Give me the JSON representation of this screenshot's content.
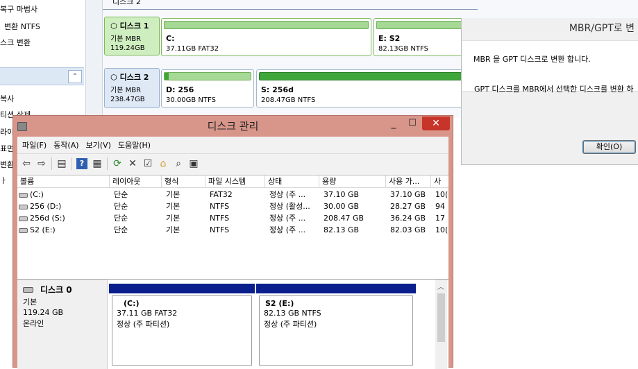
{
  "left_panel": {
    "items": [
      "복구 마법사",
      "변환 NTFS",
      "스크 변환"
    ],
    "items2": [
      "복사",
      "티션 삭제",
      "라이",
      "표면",
      "변환",
      "ㅏ"
    ]
  },
  "top": {
    "title": "디스크 2",
    "disks": [
      {
        "name": "디스크 1",
        "type": "기본 MBR",
        "size": "119.24GB"
      },
      {
        "name": "디스크 2",
        "type": "기본 MBR",
        "size": "238.47GB"
      }
    ],
    "parts1": [
      {
        "name": "C:",
        "info": "37.11GB FAT32"
      },
      {
        "name": "E: S2",
        "info": "82.13GB NTFS"
      }
    ],
    "parts2": [
      {
        "name": "D: 256",
        "info": "30.00GB NTFS"
      },
      {
        "name": "S: 256d",
        "info": "208.47GB NTFS"
      }
    ]
  },
  "dialog": {
    "title": "MBR/GPT로 변",
    "message": "MBR 을 GPT 디스크로 변환 합니다.",
    "description": "GPT 디스크를 MBR에서 선택한 디스크를 변환 하",
    "ok": "확인(O)"
  },
  "dm": {
    "title": "디스크 관리",
    "menus": [
      "파일(F)",
      "동작(A)",
      "보기(V)",
      "도움말(H)"
    ],
    "columns": [
      "볼륨",
      "레이아웃",
      "형식",
      "파일 시스템",
      "상태",
      "용량",
      "사용 가...",
      "사"
    ],
    "rows": [
      [
        "(C:)",
        "단순",
        "기본",
        "FAT32",
        "정상 (주 ...",
        "37.10 GB",
        "37.10 GB",
        "10("
      ],
      [
        "256 (D:)",
        "단순",
        "기본",
        "NTFS",
        "정상 (활성...",
        "30.00 GB",
        "28.27 GB",
        "94"
      ],
      [
        "256d (S:)",
        "단순",
        "기본",
        "NTFS",
        "정상 (주 ...",
        "208.47 GB",
        "36.24 GB",
        "17"
      ],
      [
        "S2 (E:)",
        "단순",
        "기본",
        "NTFS",
        "정상 (주 ...",
        "82.13 GB",
        "82.03 GB",
        "10("
      ]
    ],
    "disk0": {
      "name": "디스크 0",
      "type": "기본",
      "size": "119.24 GB",
      "status": "온라인"
    },
    "parts": [
      {
        "name": "(C:)",
        "info": "37.11 GB FAT32",
        "status": "정상 (주 파티션)"
      },
      {
        "name": "S2  (E:)",
        "info": "82.13 GB NTFS",
        "status": "정상 (주 파티션)"
      }
    ]
  }
}
